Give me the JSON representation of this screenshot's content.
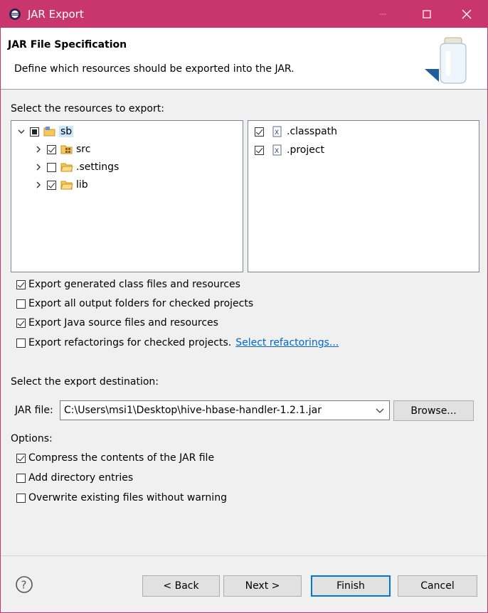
{
  "window": {
    "title": "JAR Export",
    "minimize_icon": "minimize-icon",
    "maximize_icon": "maximize-icon",
    "close_icon": "close-icon",
    "titlebar_color": "#c9366d"
  },
  "banner": {
    "title": "JAR File Specification",
    "description": "Define which resources should be exported into the JAR.",
    "icon": "jar-icon"
  },
  "resources": {
    "label": "Select the resources to export:",
    "tree": [
      {
        "label": "sb",
        "expanded": true,
        "state": "partial",
        "icon": "project-folder-icon",
        "selected": true
      },
      {
        "label": "src",
        "expanded": false,
        "state": "checked",
        "icon": "package-folder-icon"
      },
      {
        "label": ".settings",
        "expanded": false,
        "state": "unchecked",
        "icon": "folder-icon"
      },
      {
        "label": "lib",
        "expanded": false,
        "state": "checked",
        "icon": "folder-icon"
      }
    ],
    "files": [
      {
        "label": ".classpath",
        "state": "checked",
        "icon": "xml-file-icon"
      },
      {
        "label": ".project",
        "state": "checked",
        "icon": "xml-file-icon"
      }
    ]
  },
  "export_options": [
    {
      "label": "Export generated class files and resources",
      "checked": true
    },
    {
      "label": "Export all output folders for checked projects",
      "checked": false
    },
    {
      "label": "Export Java source files and resources",
      "checked": true
    },
    {
      "label": "Export refactorings for checked projects.",
      "checked": false
    }
  ],
  "select_refactorings_link": "Select refactorings...",
  "destination": {
    "label": "Select the export destination:",
    "jar_label": "JAR file:",
    "jar_value": "C:\\Users\\msi1\\Desktop\\hive-hbase-handler-1.2.1.jar",
    "browse_label": "Browse..."
  },
  "options": {
    "label": "Options:",
    "items": [
      {
        "label": "Compress the contents of the JAR file",
        "checked": true
      },
      {
        "label": "Add directory entries",
        "checked": false
      },
      {
        "label": "Overwrite existing files without warning",
        "checked": false
      }
    ]
  },
  "footer": {
    "help_icon": "help-icon",
    "back_label": "< Back",
    "next_label": "Next >",
    "finish_label": "Finish",
    "cancel_label": "Cancel"
  }
}
